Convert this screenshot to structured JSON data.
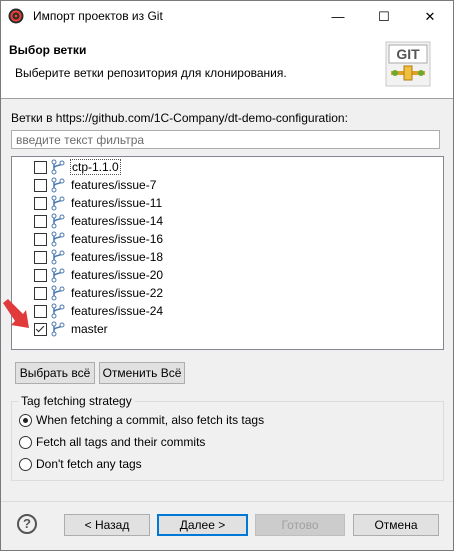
{
  "window": {
    "title": "Импорт проектов из Git"
  },
  "title_controls": {
    "minimize": "—",
    "maximize": "☐",
    "close": "✕"
  },
  "banner": {
    "heading": "Выбор ветки",
    "description": "Выберите ветки репозитория для клонирования.",
    "logo_text": "GIT"
  },
  "branches": {
    "label": "Ветки в https://github.com/1C-Company/dt-demo-configuration:",
    "filter_placeholder": "введите текст фильтра",
    "items": [
      {
        "name": "ctp-1.1.0",
        "checked": false
      },
      {
        "name": "features/issue-7",
        "checked": false
      },
      {
        "name": "features/issue-11",
        "checked": false
      },
      {
        "name": "features/issue-14",
        "checked": false
      },
      {
        "name": "features/issue-16",
        "checked": false
      },
      {
        "name": "features/issue-18",
        "checked": false
      },
      {
        "name": "features/issue-20",
        "checked": false
      },
      {
        "name": "features/issue-22",
        "checked": false
      },
      {
        "name": "features/issue-24",
        "checked": false
      },
      {
        "name": "master",
        "checked": true
      }
    ]
  },
  "buttons": {
    "select_all": "Выбрать всё",
    "deselect_all": "Отменить Всё",
    "back": "< Назад",
    "next": "Далее >",
    "finish": "Готово",
    "cancel": "Отмена",
    "help": "?"
  },
  "tag_strategy": {
    "legend": "Tag fetching strategy",
    "options": [
      {
        "label": "When fetching a commit, also fetch its tags",
        "selected": true
      },
      {
        "label": "Fetch all tags and their commits",
        "selected": false
      },
      {
        "label": "Don't fetch any tags",
        "selected": false
      }
    ]
  },
  "colors": {
    "accent": "#0078d7",
    "arrow": "#e03a3a",
    "branch_icon": "#4a7ab0"
  }
}
